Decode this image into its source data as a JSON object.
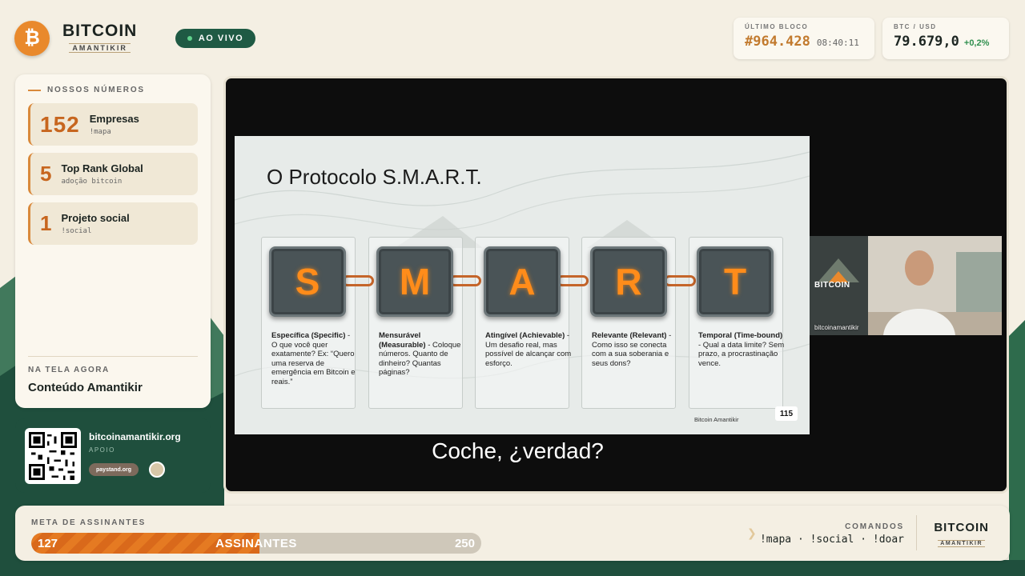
{
  "brand": {
    "title": "BITCOIN",
    "subtitle": "AMANTIKIR",
    "logo_glyph": "₿"
  },
  "live": {
    "label": "AO VIVO"
  },
  "last_block": {
    "label": "ÚLTIMO BLOCO",
    "number": "#964.428",
    "time": "08:40:11"
  },
  "price": {
    "label": "BTC / USD",
    "value": "79.679,0",
    "change": "+0,2%"
  },
  "numbers": {
    "title": "NOSSOS NÚMEROS",
    "items": [
      {
        "value": "152",
        "name": "Empresas",
        "sub": "!mapa"
      },
      {
        "value": "5",
        "name": "Top Rank Global",
        "sub": "adoção bitcoin"
      },
      {
        "value": "1",
        "name": "Projeto social",
        "sub": "!social"
      }
    ]
  },
  "now_playing": {
    "label": "NA TELA AGORA",
    "value": "Conteúdo Amantikir"
  },
  "support": {
    "site": "bitcoinamantikir.org",
    "label": "APOIO",
    "badge": "paystand.org"
  },
  "slide": {
    "title": "O Protocolo S.M.A.R.T.",
    "letters": [
      "S",
      "M",
      "A",
      "R",
      "T"
    ],
    "columns": [
      {
        "head": "Específica (Specific)",
        "text": " - O que você quer exatamente? Ex: “Quero uma reserva de emergência em Bitcoin e reais.”"
      },
      {
        "head": "Mensurável (Measurable)",
        "text": " - Coloque números. Quanto de dinheiro? Quantas páginas?"
      },
      {
        "head": "Atingível (Achievable)",
        "text": " - Um desafio real, mas possível de alcançar com esforço."
      },
      {
        "head": "Relevante (Relevant)",
        "text": " - Como isso se conecta com a sua soberania e seus dons?"
      },
      {
        "head": "Temporal (Time-bound)",
        "text": " - Qual a data limite? Sem prazo, a procrastinação vence."
      }
    ],
    "footer": "Bitcoin Amantikir",
    "page": "115"
  },
  "subtitle": "Coche, ¿verdad?",
  "camera": {
    "logo_text": "BITCOIN",
    "name": "bitcoinamantikir"
  },
  "goal": {
    "label": "META DE ASSINANTES",
    "current": "127",
    "center_label": "ASSINANTES",
    "max": "250",
    "progress_fraction": 0.508
  },
  "commands": {
    "label": "COMANDOS",
    "list": "!mapa · !social · !doar"
  },
  "footer_brand": {
    "title": "BITCOIN",
    "subtitle": "AMANTIKIR"
  },
  "colors": {
    "accent": "#e9892c",
    "green": "#1f5a44",
    "price_up": "#2f8f4e"
  }
}
